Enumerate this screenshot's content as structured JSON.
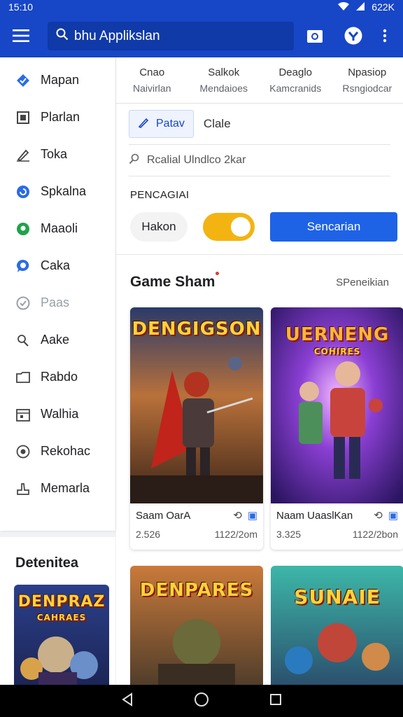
{
  "status_bar": {
    "time": "15:10",
    "right_text": "622K"
  },
  "app_bar": {
    "search_text": "bhu Applikslan"
  },
  "sidebar": {
    "items": [
      {
        "label": "Mapan",
        "icon": "diamond-icon"
      },
      {
        "label": "Plarlan",
        "icon": "square-icon"
      },
      {
        "label": "Toka",
        "icon": "pen-icon"
      },
      {
        "label": "Spkalna",
        "icon": "swirl-icon"
      },
      {
        "label": "Maaoli",
        "icon": "location-icon"
      },
      {
        "label": "Caka",
        "icon": "chat-icon"
      },
      {
        "label": "Paas",
        "icon": "check-circle-icon"
      },
      {
        "label": "Aake",
        "icon": "puzzle-icon"
      },
      {
        "label": "Rabdo",
        "icon": "folder-icon"
      },
      {
        "label": "Walhia",
        "icon": "calendar-icon"
      },
      {
        "label": "Rekohac",
        "icon": "target-icon"
      },
      {
        "label": "Memarla",
        "icon": "thumb-icon"
      }
    ],
    "featured_title": "Detenitea",
    "featured_logo_line1": "DENPRAZ",
    "featured_logo_line2": "CAHRAES"
  },
  "tabs": [
    {
      "label": "Cnao",
      "sub": "Naivirlan"
    },
    {
      "label": "Salkok",
      "sub": "Mendaioes"
    },
    {
      "label": "Deaglo",
      "sub": "Kamcranids"
    },
    {
      "label": "Npasiop",
      "sub": "Rsngiodcar"
    }
  ],
  "segment": {
    "active": "Patav",
    "inactive": "Clale"
  },
  "filter_placeholder": "Rcalial Ulndlco 2kar",
  "section_label": "PENCAGIAI",
  "controls": {
    "pill_label": "Hakon",
    "primary_button": "Sencarian",
    "toggle_on": true
  },
  "section": {
    "title": "Game Sham",
    "link": "SPeneikian"
  },
  "cards": [
    {
      "logo": "DENGIGSON",
      "name": "Saam OarA",
      "stat_left": "2.526",
      "stat_right": "1122/2om"
    },
    {
      "logo": "UERNENG",
      "logo2": "COHIRES",
      "name": "Naam UaaslKan",
      "stat_left": "3.325",
      "stat_right": "1122/2bon"
    }
  ],
  "cards_bottom": [
    {
      "logo": "DENPARES"
    },
    {
      "logo": "SUNAIE"
    }
  ],
  "colors": {
    "primary": "#1746c7",
    "button": "#1e63e6",
    "toggle": "#f3b412"
  }
}
